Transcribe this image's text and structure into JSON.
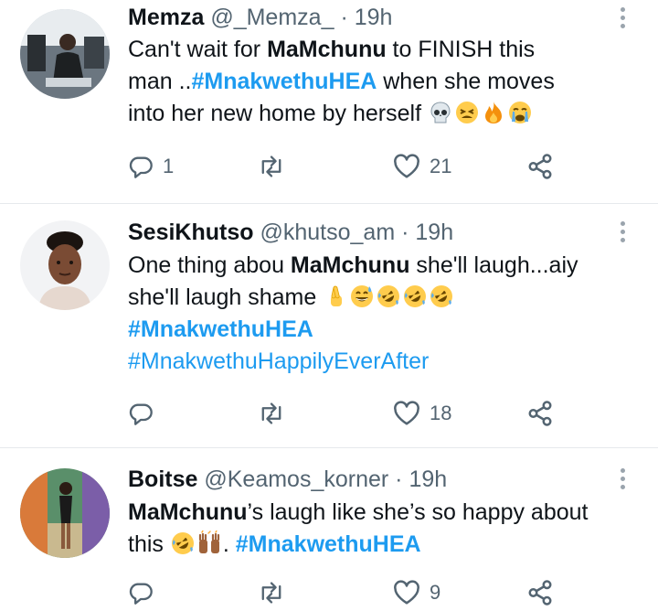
{
  "tweets": [
    {
      "name": "Memza",
      "handle": "@_Memza_",
      "separator": "·",
      "time": "19h",
      "body": {
        "l1a": "Can't wait for ",
        "l1b": "MaMchunu",
        "l1c": " to FINISH this",
        "l2a": "man ..",
        "l2b": "#MnakwethuHEA",
        "l2c": " when she moves",
        "l3a": "into her new home by herself "
      },
      "emojis": [
        "skull-emoji",
        "tired-face-emoji",
        "fire-emoji",
        "crying-face-emoji"
      ],
      "replies": "1",
      "likes": "21"
    },
    {
      "name": "SesiKhutso",
      "handle": "@khutso_am",
      "separator": "·",
      "time": "19h",
      "body": {
        "l1a": "One thing abou ",
        "l1b": "MaMchunu",
        "l1c": " she'll laugh...aiy",
        "l2a": "she'll laugh shame ",
        "l3": "#MnakwethuHEA",
        "l4": "#MnakwethuHappilyEverAfter"
      },
      "emojis": [
        "crossed-fingers-emoji",
        "grinning-sweat-emoji",
        "rofl-emoji",
        "rofl-emoji",
        "rofl-emoji"
      ],
      "replies": "",
      "likes": "18"
    },
    {
      "name": "Boitse",
      "handle": "@Keamos_korner",
      "separator": "·",
      "time": "19h",
      "body": {
        "l1a": "MaMchunu",
        "l1b": "’s laugh like she’s so happy about",
        "l2a": "this ",
        "l2b": ". ",
        "l2c": "#MnakwethuHEA"
      },
      "emojis": [
        "rofl-emoji",
        "raising-hands-emoji"
      ],
      "replies": "",
      "likes": "9"
    }
  ],
  "colors": {
    "text": "#0f1419",
    "secondary": "#536471",
    "link": "#1d9bf0",
    "divider": "#e6e9ec"
  }
}
